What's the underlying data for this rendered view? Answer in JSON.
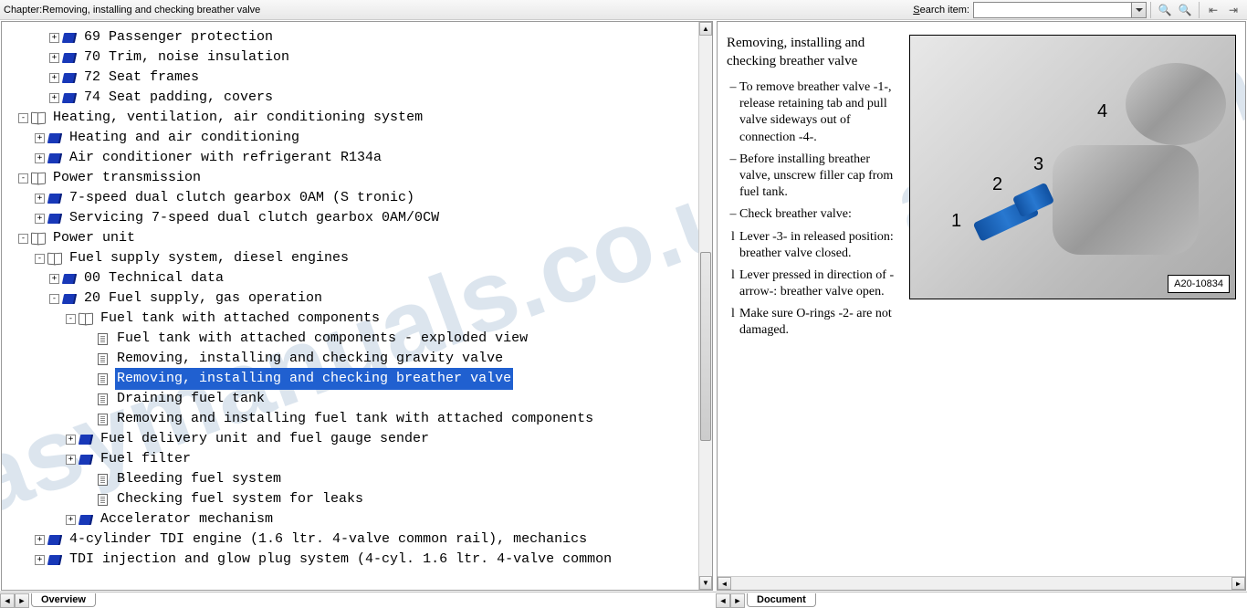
{
  "toolbar": {
    "chapter_prefix": "Chapter:",
    "chapter_title": "Removing, installing and checking breather valve",
    "search_label_pre": "S",
    "search_label_post": "earch item:",
    "search_value": ""
  },
  "tree": [
    {
      "indent": 2,
      "expander": "+",
      "icon": "book-blue",
      "label": "69 Passenger protection"
    },
    {
      "indent": 2,
      "expander": "+",
      "icon": "book-blue",
      "label": "70 Trim, noise insulation"
    },
    {
      "indent": 2,
      "expander": "+",
      "icon": "book-blue",
      "label": "72 Seat frames"
    },
    {
      "indent": 2,
      "expander": "+",
      "icon": "book-blue",
      "label": "74 Seat padding, covers"
    },
    {
      "indent": 0,
      "expander": "-",
      "icon": "book-open",
      "label": "Heating, ventilation, air conditioning system"
    },
    {
      "indent": 1,
      "expander": "+",
      "icon": "book-blue",
      "label": "Heating and air conditioning"
    },
    {
      "indent": 1,
      "expander": "+",
      "icon": "book-blue",
      "label": "Air conditioner with refrigerant R134a"
    },
    {
      "indent": 0,
      "expander": "-",
      "icon": "book-open",
      "label": "Power transmission"
    },
    {
      "indent": 1,
      "expander": "+",
      "icon": "book-blue",
      "label": "7-speed dual clutch gearbox 0AM (S tronic)"
    },
    {
      "indent": 1,
      "expander": "+",
      "icon": "book-blue",
      "label": "Servicing 7-speed dual clutch gearbox 0AM/0CW"
    },
    {
      "indent": 0,
      "expander": "-",
      "icon": "book-open",
      "label": "Power unit"
    },
    {
      "indent": 1,
      "expander": "-",
      "icon": "book-open",
      "label": "Fuel supply system, diesel engines"
    },
    {
      "indent": 2,
      "expander": "+",
      "icon": "book-blue",
      "label": "00 Technical data"
    },
    {
      "indent": 2,
      "expander": "-",
      "icon": "book-blue",
      "label": "20 Fuel supply, gas operation"
    },
    {
      "indent": 3,
      "expander": "-",
      "icon": "book-open",
      "label": "Fuel tank with attached components"
    },
    {
      "indent": 4,
      "expander": "",
      "icon": "doc",
      "label": "Fuel tank with attached components - exploded view"
    },
    {
      "indent": 4,
      "expander": "",
      "icon": "doc",
      "label": "Removing, installing and checking gravity valve"
    },
    {
      "indent": 4,
      "expander": "",
      "icon": "doc",
      "label": "Removing, installing and checking breather valve",
      "selected": true
    },
    {
      "indent": 4,
      "expander": "",
      "icon": "doc",
      "label": "Draining fuel tank"
    },
    {
      "indent": 4,
      "expander": "",
      "icon": "doc",
      "label": "Removing and installing fuel tank with attached components"
    },
    {
      "indent": 3,
      "expander": "+",
      "icon": "book-blue",
      "label": "Fuel delivery unit and fuel gauge sender"
    },
    {
      "indent": 3,
      "expander": "+",
      "icon": "book-blue",
      "label": "Fuel filter"
    },
    {
      "indent": 4,
      "expander": "",
      "icon": "doc",
      "label": "Bleeding fuel system"
    },
    {
      "indent": 4,
      "expander": "",
      "icon": "doc",
      "label": "Checking fuel system for leaks"
    },
    {
      "indent": 3,
      "expander": "+",
      "icon": "book-blue",
      "label": "Accelerator mechanism"
    },
    {
      "indent": 1,
      "expander": "+",
      "icon": "book-blue",
      "label": "4-cylinder TDI engine (1.6 ltr. 4-valve common rail), mechanics"
    },
    {
      "indent": 1,
      "expander": "+",
      "icon": "book-blue",
      "label": "TDI injection and glow plug system (4-cyl. 1.6 ltr. 4-valve common"
    }
  ],
  "content": {
    "title": "Removing, installing and checking breather valve",
    "items": [
      {
        "bullet": "–",
        "text": "To remove breather valve -1-, release retaining tab and pull valve sideways out of connection -4-."
      },
      {
        "bullet": "–",
        "text": "Before installing breather valve, unscrew filler cap from fuel tank."
      },
      {
        "bullet": "–",
        "text": "Check breather valve:"
      },
      {
        "bullet": "l",
        "text": "Lever -3- in released position: breather valve closed."
      },
      {
        "bullet": "l",
        "text": "Lever pressed in direction of -arrow-: breather valve open."
      },
      {
        "bullet": "l",
        "text": "Make sure O-rings -2- are not damaged."
      }
    ],
    "figure_id": "A20-10834",
    "callouts": {
      "c1": "1",
      "c2": "2",
      "c3": "3",
      "c4": "4"
    }
  },
  "watermark": "asymanuals.co.uk",
  "tabs": {
    "left": "Overview",
    "right": "Document"
  }
}
